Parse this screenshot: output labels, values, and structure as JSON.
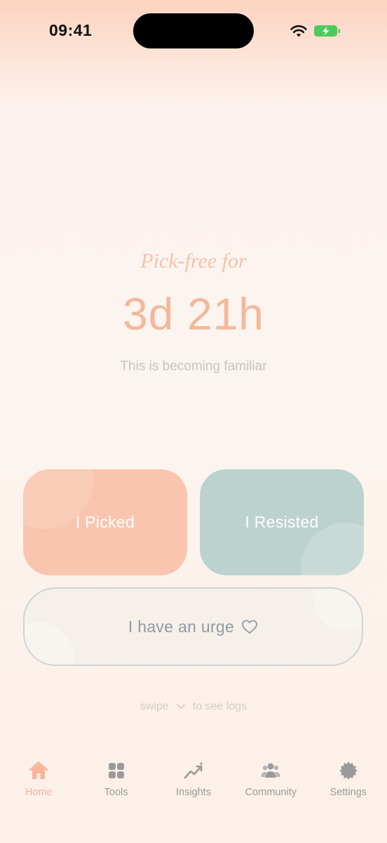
{
  "status_bar": {
    "time": "09:41"
  },
  "streak": {
    "label": "Pick-free for",
    "value": "3d 21h",
    "message": "This is becoming familiar"
  },
  "actions": {
    "picked_label": "I Picked",
    "resisted_label": "I Resisted",
    "urge_label": "I have an urge"
  },
  "swipe_hint": {
    "prefix": "swipe",
    "suffix": "to see logs"
  },
  "tabs": [
    {
      "label": "Home",
      "icon": "home-icon",
      "active": true
    },
    {
      "label": "Tools",
      "icon": "grid-icon",
      "active": false
    },
    {
      "label": "Insights",
      "icon": "trend-up-icon",
      "active": false
    },
    {
      "label": "Community",
      "icon": "people-icon",
      "active": false
    },
    {
      "label": "Settings",
      "icon": "gear-icon",
      "active": false
    }
  ],
  "colors": {
    "accent": "#F8B59A",
    "picked_button": "#F9C5AE",
    "resisted_button": "#BCD2CE",
    "inactive_tab": "#9A9A9A"
  }
}
